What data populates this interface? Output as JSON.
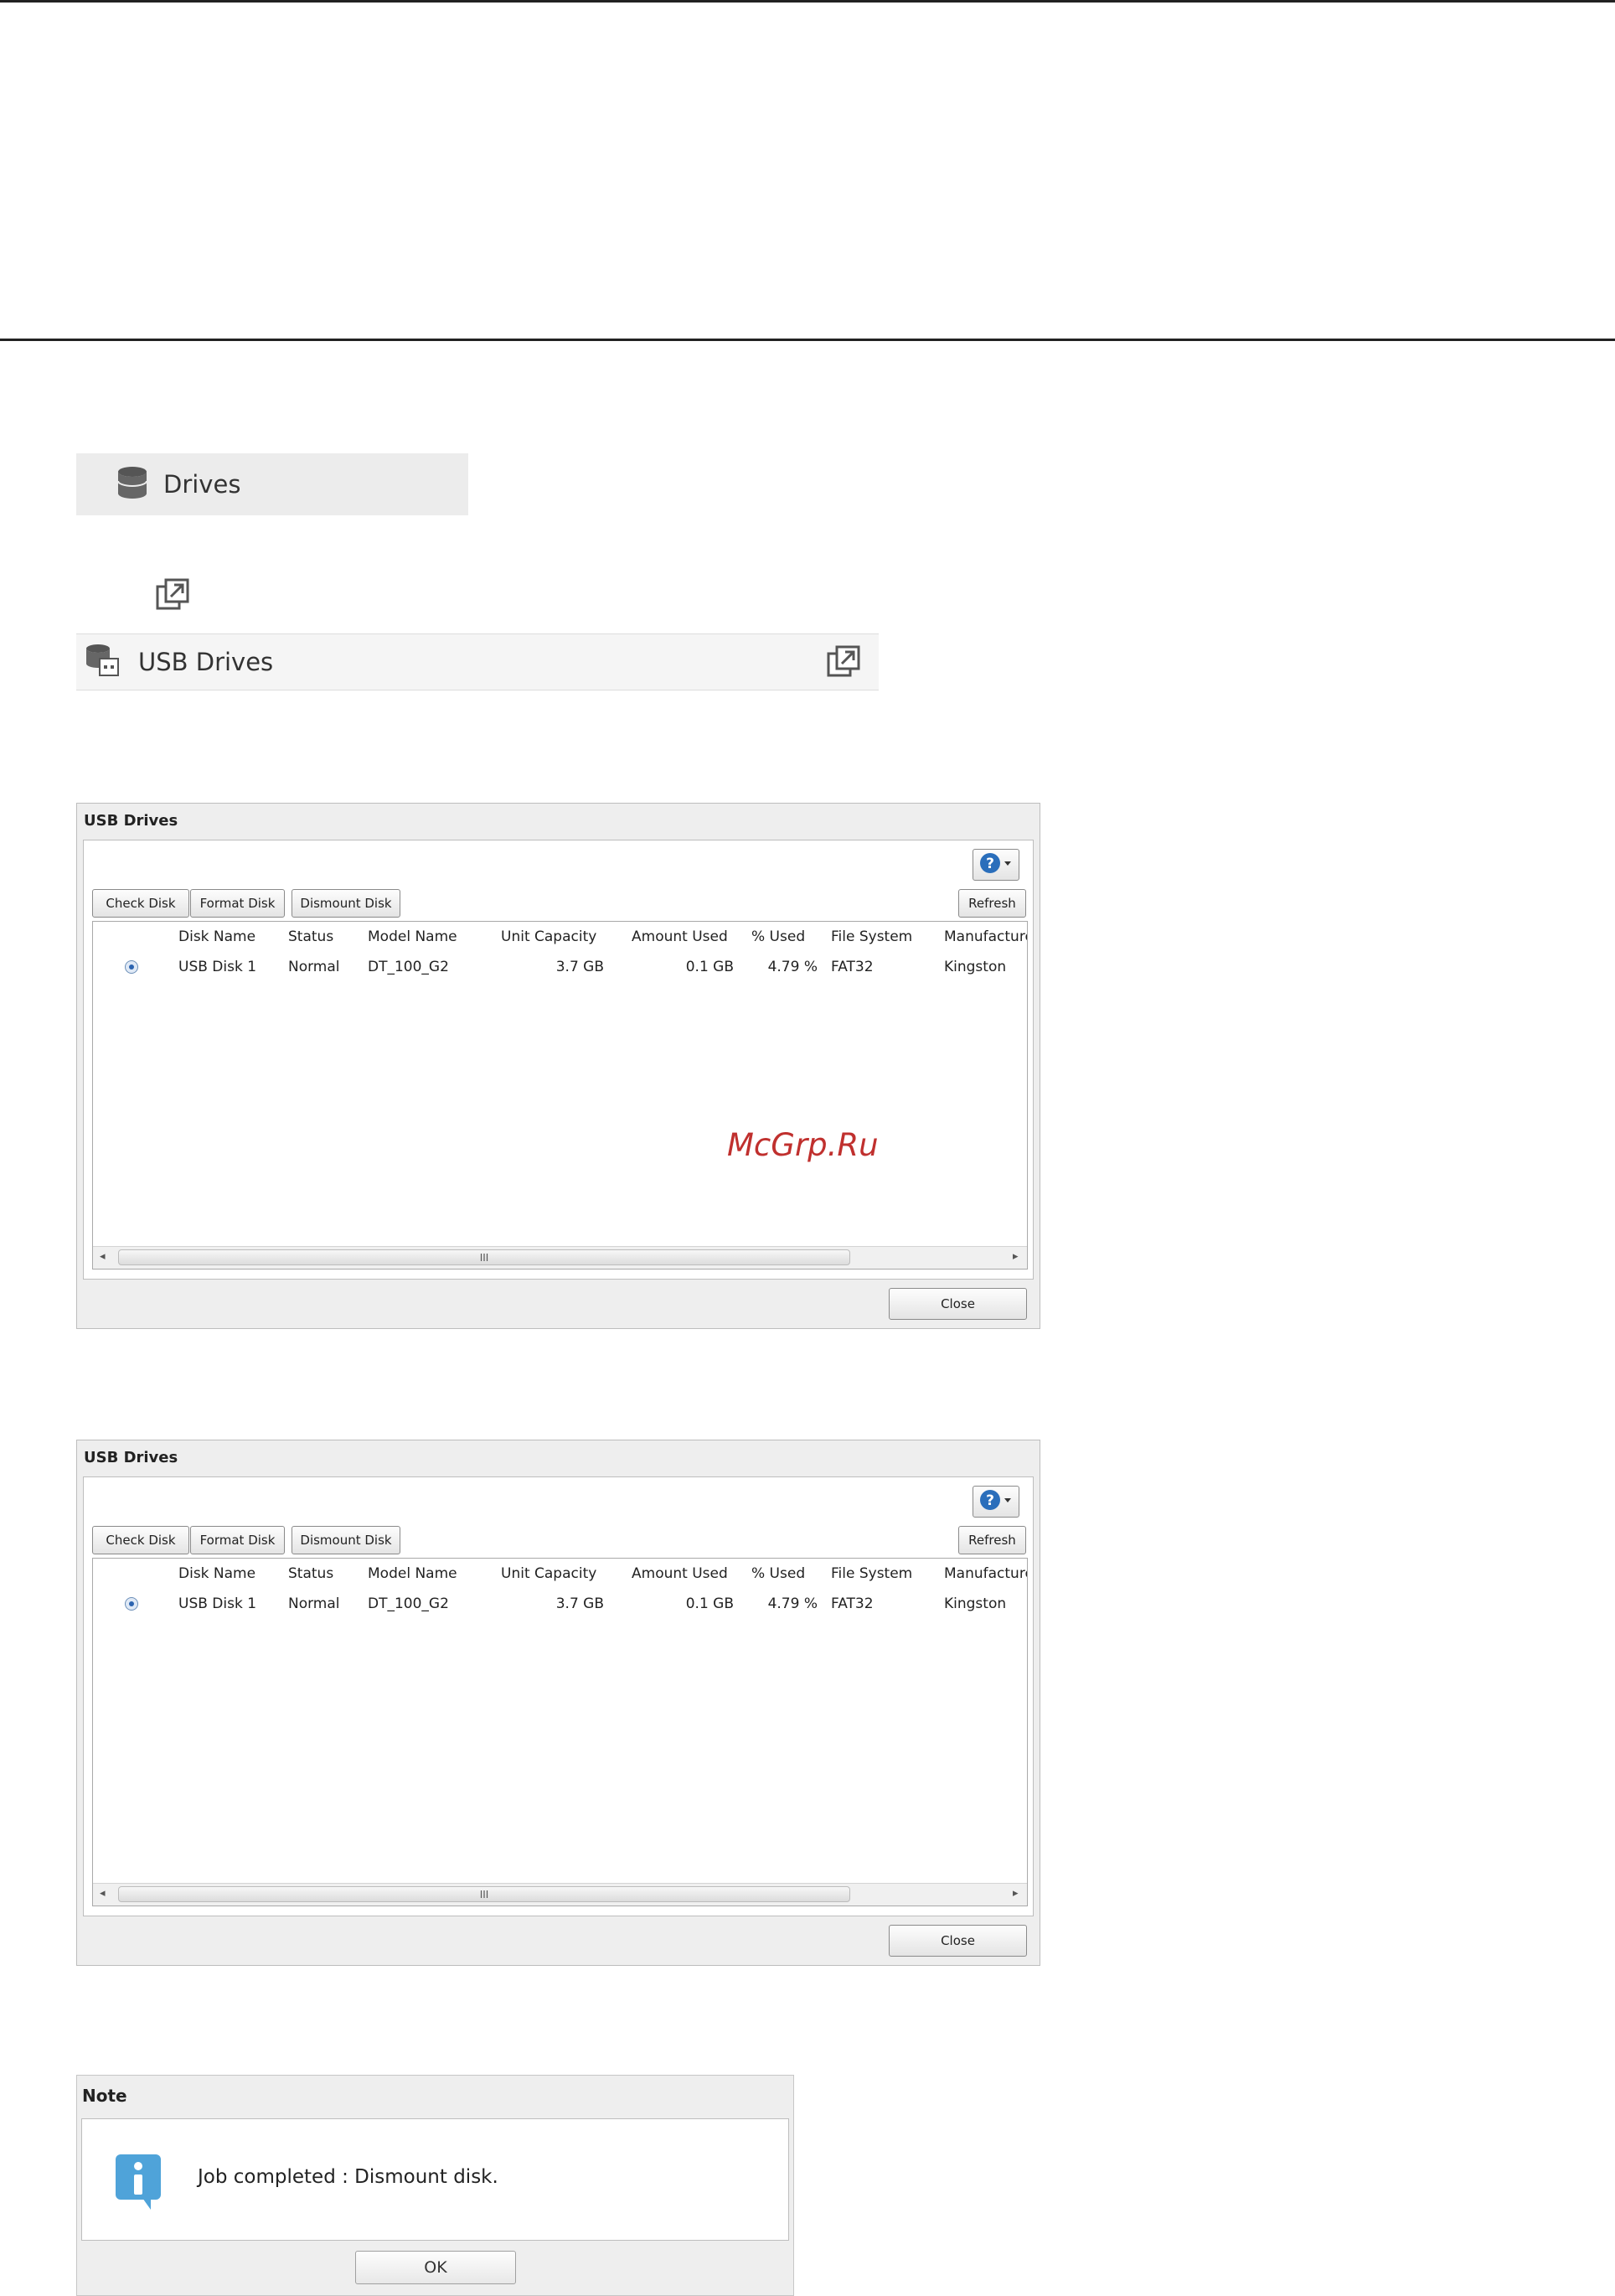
{
  "nav": {
    "drives_label": "Drives",
    "usb_drives_label": "USB Drives"
  },
  "dialogs": [
    {
      "title": "USB Drives",
      "buttons": {
        "check": "Check Disk",
        "format": "Format Disk",
        "dismount": "Dismount Disk",
        "refresh": "Refresh",
        "close": "Close"
      },
      "columns": [
        "Disk Name",
        "Status",
        "Model Name",
        "Unit Capacity",
        "Amount Used",
        "% Used",
        "File System",
        "Manufacture"
      ],
      "rows": [
        {
          "disk_name": "USB Disk 1",
          "status": "Normal",
          "model": "DT_100_G2",
          "capacity": "3.7 GB",
          "used": "0.1 GB",
          "percent": "4.79 %",
          "fs": "FAT32",
          "manufacturer": "Kingston"
        }
      ],
      "scroll_grip": "III"
    },
    {
      "title": "USB Drives",
      "buttons": {
        "check": "Check Disk",
        "format": "Format Disk",
        "dismount": "Dismount Disk",
        "refresh": "Refresh",
        "close": "Close"
      },
      "columns": [
        "Disk Name",
        "Status",
        "Model Name",
        "Unit Capacity",
        "Amount Used",
        "% Used",
        "File System",
        "Manufacture"
      ],
      "rows": [
        {
          "disk_name": "USB Disk 1",
          "status": "Normal",
          "model": "DT_100_G2",
          "capacity": "3.7 GB",
          "used": "0.1 GB",
          "percent": "4.79 %",
          "fs": "FAT32",
          "manufacturer": "Kingston"
        }
      ],
      "scroll_grip": "III"
    }
  ],
  "watermark": "McGrp.Ru",
  "note": {
    "title": "Note",
    "message": "Job completed : Dismount disk.",
    "ok": "OK"
  },
  "icons": {
    "drives": "database-icon",
    "expand": "external-window-icon",
    "usb": "usb-drive-icon",
    "help": "help-icon",
    "info": "info-icon"
  },
  "colors": {
    "help_blue": "#2a6ebb",
    "info_blue": "#4fa3d9",
    "watermark": "#c0302e"
  }
}
